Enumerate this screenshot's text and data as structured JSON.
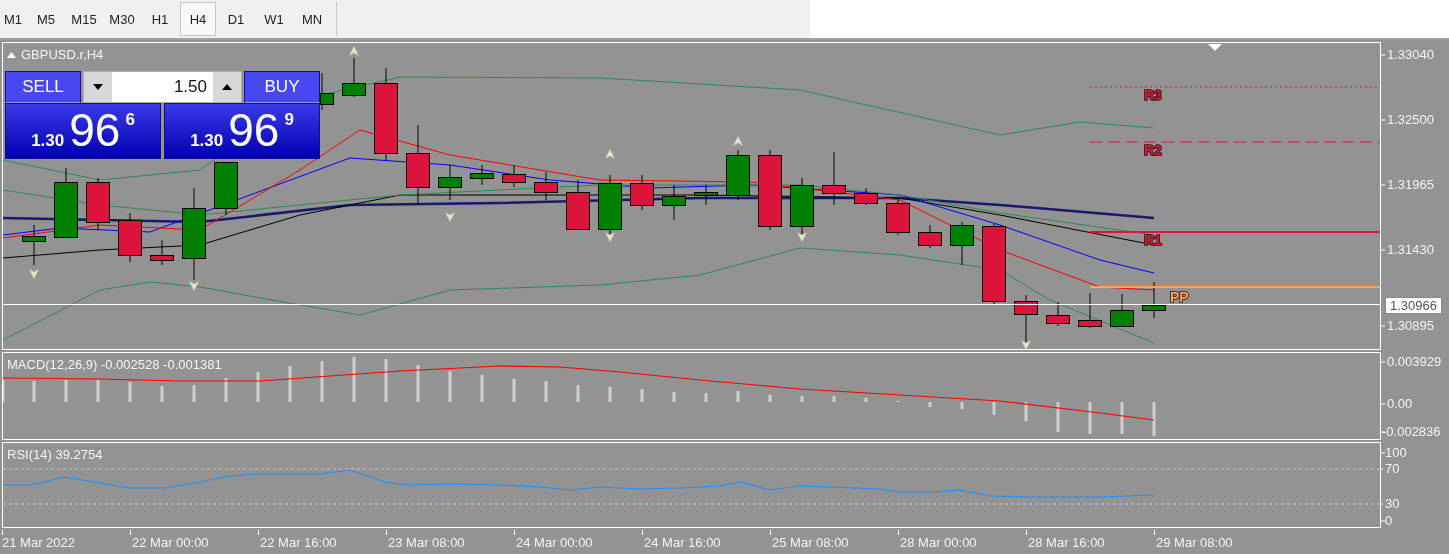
{
  "toolbar": {
    "timeframes": [
      {
        "label": "M1",
        "selected": false
      },
      {
        "label": "M5",
        "selected": false
      },
      {
        "label": "M15",
        "selected": false
      },
      {
        "label": "M30",
        "selected": false
      },
      {
        "label": "H1",
        "selected": false
      },
      {
        "label": "H4",
        "selected": true
      },
      {
        "label": "D1",
        "selected": false
      },
      {
        "label": "W1",
        "selected": false
      },
      {
        "label": "MN",
        "selected": false
      }
    ]
  },
  "chart": {
    "title": "GBPUSD.r,H4",
    "trade_panel": {
      "sell": {
        "label": "SELL",
        "price_prefix": "1.30",
        "price_main": "96",
        "price_pip": "6"
      },
      "lot": {
        "value": "1.50"
      },
      "buy": {
        "label": "BUY",
        "price_prefix": "1.30",
        "price_main": "96",
        "price_pip": "9"
      }
    },
    "pivots": [
      {
        "label": "R3",
        "kind": "dotted",
        "color": "#dc143c"
      },
      {
        "label": "R2",
        "kind": "dashed",
        "color": "#dc143c"
      },
      {
        "label": "R1",
        "kind": "solid",
        "color": "#dc143c"
      },
      {
        "label": "PP",
        "kind": "solid",
        "color": "#ffa366"
      }
    ],
    "price_axis": {
      "ticks": [
        "1.33040",
        "1.32500",
        "1.31965",
        "1.31430",
        "1.30895"
      ],
      "current": "1.30966"
    }
  },
  "macd": {
    "label": "MACD(12,26,9) -0.002528 -0.001381",
    "axis_ticks": [
      "0.003929",
      "0.00",
      "-0.002836"
    ]
  },
  "rsi": {
    "label": "RSI(14) 39.2754",
    "axis_ticks": [
      "100",
      "70",
      "30",
      "0"
    ]
  },
  "time_axis": {
    "labels": [
      "21 Mar 2022",
      "22 Mar 00:00",
      "22 Mar 16:00",
      "23 Mar 08:00",
      "24 Mar 00:00",
      "24 Mar 16:00",
      "25 Mar 08:00",
      "28 Mar 00:00",
      "28 Mar 16:00",
      "29 Mar 08:00"
    ]
  }
}
